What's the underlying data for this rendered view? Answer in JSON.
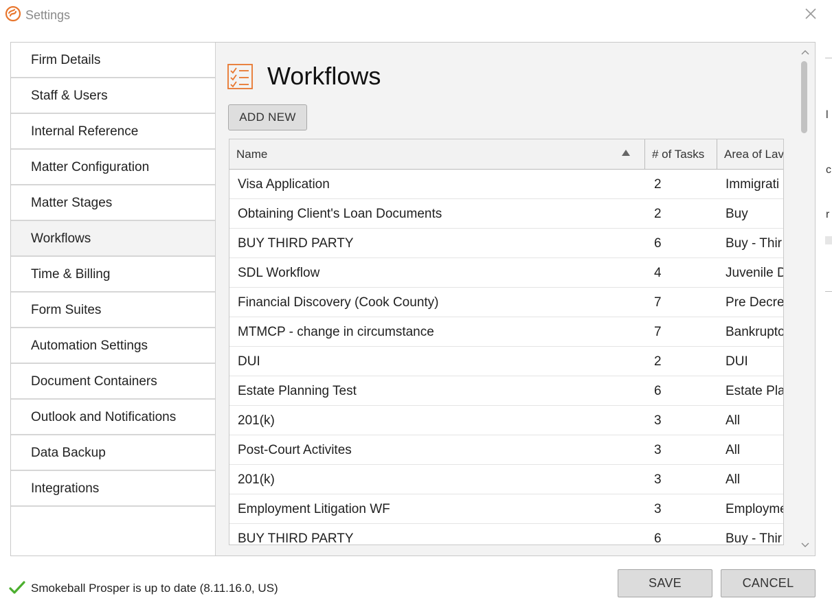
{
  "window": {
    "title": "Settings"
  },
  "sidebar": {
    "items": [
      {
        "label": "Firm Details"
      },
      {
        "label": "Staff & Users"
      },
      {
        "label": "Internal Reference"
      },
      {
        "label": "Matter Configuration"
      },
      {
        "label": "Matter Stages"
      },
      {
        "label": "Workflows",
        "active": true
      },
      {
        "label": "Time & Billing"
      },
      {
        "label": "Form Suites"
      },
      {
        "label": "Automation Settings"
      },
      {
        "label": "Document Containers"
      },
      {
        "label": "Outlook and Notifications"
      },
      {
        "label": "Data Backup"
      },
      {
        "label": "Integrations"
      }
    ]
  },
  "main": {
    "title": "Workflows",
    "add_new_label": "ADD NEW",
    "table": {
      "columns": [
        "Name",
        "# of Tasks",
        "Area of Lav"
      ],
      "sort": {
        "column": "Name",
        "direction": "ascending"
      },
      "rows": [
        {
          "name": "Visa Application",
          "tasks": "2",
          "area": "Immigrati"
        },
        {
          "name": "Obtaining Client's Loan Documents",
          "tasks": "2",
          "area": "Buy"
        },
        {
          "name": "BUY THIRD PARTY",
          "tasks": "6",
          "area": "Buy - Thir"
        },
        {
          "name": "SDL Workflow",
          "tasks": "4",
          "area": "Juvenile D"
        },
        {
          "name": "Financial Discovery (Cook County)",
          "tasks": "7",
          "area": "Pre Decre"
        },
        {
          "name": "MTMCP - change in circumstance",
          "tasks": "7",
          "area": "Bankrupto"
        },
        {
          "name": "DUI",
          "tasks": "2",
          "area": "DUI"
        },
        {
          "name": "Estate Planning Test",
          "tasks": "6",
          "area": "Estate Pla"
        },
        {
          "name": "201(k)",
          "tasks": "3",
          "area": "All"
        },
        {
          "name": "Post-Court Activites",
          "tasks": "3",
          "area": "All"
        },
        {
          "name": "201(k)",
          "tasks": "3",
          "area": "All"
        },
        {
          "name": "Employment Litigation WF",
          "tasks": "3",
          "area": "Employme"
        },
        {
          "name": "BUY THIRD PARTY",
          "tasks": "6",
          "area": "Buy - Thir"
        }
      ]
    }
  },
  "footer": {
    "status_text": "Smokeball Prosper is up to date (8.11.16.0, US)",
    "save_label": "SAVE",
    "cancel_label": "CANCEL"
  },
  "colors": {
    "accent_orange": "#e8762d",
    "status_green": "#4caf2f",
    "button_gray": "#dcdcdc",
    "panel_gray": "#f3f3f3"
  },
  "icons": {
    "app_logo": "smokeball-logo-icon",
    "close": "close-icon",
    "page": "checklist-icon",
    "sort": "sort-ascending-icon",
    "status": "checkmark-icon",
    "scroll_up": "chevron-up-icon",
    "scroll_down": "chevron-down-icon"
  }
}
